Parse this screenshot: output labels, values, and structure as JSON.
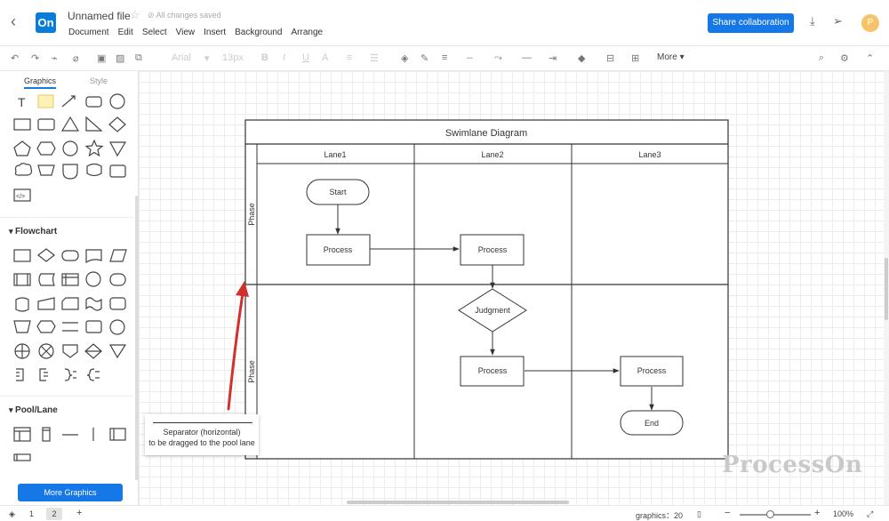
{
  "header": {
    "logo_text": "On",
    "file_name": "Unnamed file",
    "save_status": "All changes saved",
    "menu": [
      "Document",
      "Edit",
      "Select",
      "View",
      "Insert",
      "Background",
      "Arrange"
    ],
    "share_label": "Share collaboration",
    "avatar_letter": "P"
  },
  "toolbar": {
    "font_name": "Arial",
    "font_size": "13px",
    "more_label": "More"
  },
  "sidebar": {
    "tabs": [
      "Graphics",
      "Style"
    ],
    "sections": {
      "flowchart": "Flowchart",
      "pool_lane": "Pool/Lane"
    },
    "more_graphics": "More Graphics"
  },
  "diagram": {
    "title": "Swimlane Diagram",
    "lanes": [
      "Lane1",
      "Lane2",
      "Lane3"
    ],
    "phases": [
      "Phase",
      "Phase"
    ],
    "nodes": {
      "start": "Start",
      "process1": "Process",
      "process2": "Process",
      "judgment": "Judgment",
      "process3": "Process",
      "process4": "Process",
      "end": "End"
    }
  },
  "tooltip": {
    "line1": "Separator (horizontal)",
    "line2": "to be dragged to the pool lane"
  },
  "watermark": "ProcessOn",
  "status": {
    "pages": [
      "1",
      "2"
    ],
    "graphics_label": "graphics：20",
    "zoom": "100%"
  },
  "colors": {
    "accent": "#1677e6",
    "logo": "#0a7dda",
    "arrow_annotation": "#d0312d"
  }
}
